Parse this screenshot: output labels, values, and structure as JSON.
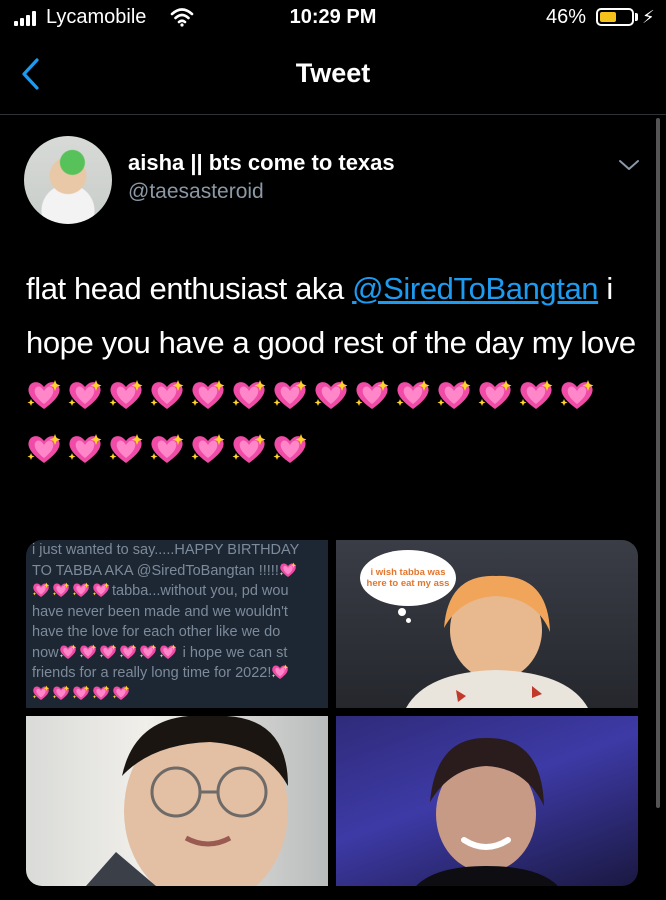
{
  "status_bar": {
    "carrier": "Lycamobile",
    "time": "10:29 PM",
    "battery_percent": "46%",
    "battery_level": 0.46,
    "battery_color": "#f5c21b"
  },
  "nav": {
    "title": "Tweet",
    "back_icon": "chevron-left-icon"
  },
  "tweet": {
    "display_name": "aisha || bts come to texas",
    "handle": "@taesasteroid",
    "text_before": "flat head enthusiast aka ",
    "mention": "@SiredToBangtan",
    "text_after": " i hope you have a good rest of the day my love ",
    "emoji": "sparkling-heart",
    "emoji_count": 21,
    "link_color": "#1d9bf0"
  },
  "media": {
    "image1_text_lines": [
      "i just wanted to say.....HAPPY BIRTHDAY",
      "TO TABBA AKA @SiredToBangtan !!!!!",
      "tabba...without you, pd wou",
      "have never been made and we wouldn't",
      "have the love for each other like we do",
      "now",
      "i hope we can st",
      "friends for a really long time for 2022!"
    ],
    "image2_bubble_text": "i wish tabba was here to eat my ass"
  }
}
